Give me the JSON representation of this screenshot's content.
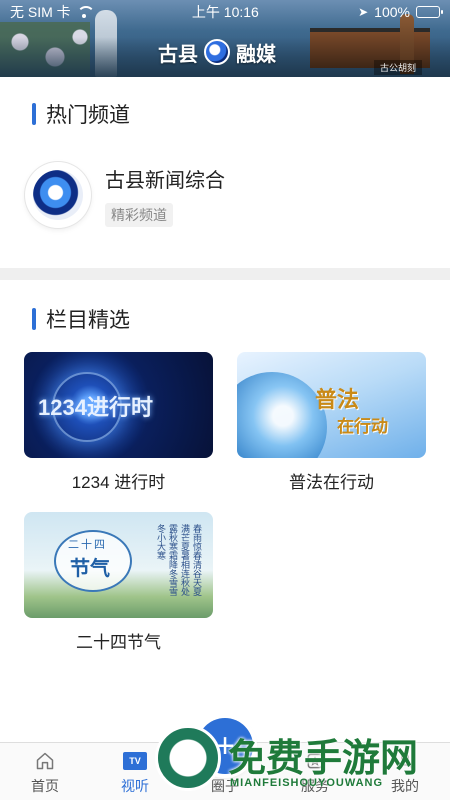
{
  "status_bar": {
    "carrier": "无 SIM 卡",
    "time": "上午 10:16",
    "battery": "100%",
    "battery_level": 1.0
  },
  "header": {
    "brand_left": "古县",
    "brand_right": "融媒",
    "plaque": "古公胡刻"
  },
  "hot_channels": {
    "title": "热门频道",
    "items": [
      {
        "name": "古县新闻综合",
        "tag": "精彩频道"
      }
    ]
  },
  "column_picks": {
    "title": "栏目精选",
    "items": [
      {
        "title": "1234 进行时",
        "thumb_text": "1234进行时"
      },
      {
        "title": "普法在行动",
        "thumb_text_1": "普法",
        "thumb_text_2": "在行动"
      },
      {
        "title": "二十四节气",
        "thumb_text_1": "二十四",
        "thumb_text_2": "节气",
        "poem": "春雨惊春清谷天夏满芒夏暑相连秋处露秋寒霜降冬雪雪冬小大寒"
      }
    ]
  },
  "tab_bar": {
    "tabs": [
      {
        "label": "首页",
        "icon": "home-icon",
        "active": false
      },
      {
        "label": "视听",
        "icon": "tv-icon",
        "active": true
      },
      {
        "label": "圈子",
        "icon": "add-icon",
        "active": false
      },
      {
        "label": "服务",
        "icon": "service-icon",
        "active": false
      },
      {
        "label": "我的",
        "icon": "profile-icon",
        "active": false
      }
    ],
    "tv_badge": "TV",
    "accent_color": "#2d6fd6"
  },
  "watermark": {
    "text": "免费手游网",
    "subtext": "MIANFEISHOUYOUWANG"
  }
}
